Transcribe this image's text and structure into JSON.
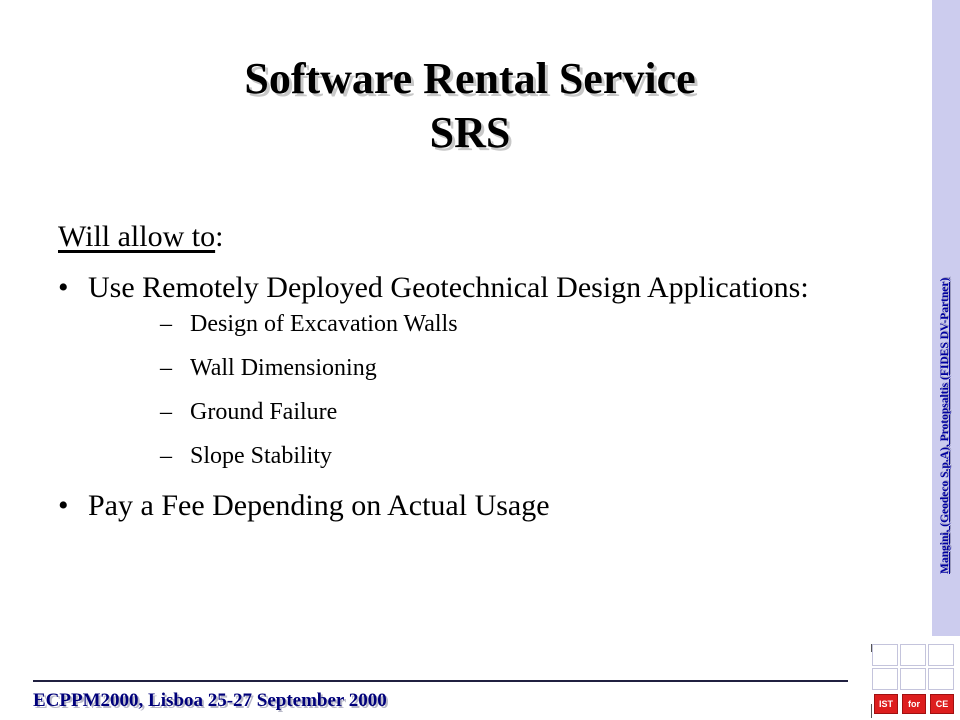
{
  "title": {
    "line1": "Software Rental Service",
    "line2": "SRS"
  },
  "intro": {
    "underlined": "Will allow to",
    "suffix": ":"
  },
  "bullet_glyph": "•",
  "dash_glyph": "–",
  "bullets": [
    {
      "text": "Use Remotely Deployed Geotechnical Design Applications:",
      "subitems": [
        "Design of Excavation Walls",
        "Wall Dimensioning",
        "Ground Failure",
        "Slope Stability"
      ]
    },
    {
      "text": "Pay a Fee Depending on Actual Usage"
    }
  ],
  "side_credit": "Mangini, (Geodeco S.p.A), Protopsaltis (FIDES DV-Partner)",
  "footer": "ECPPM2000, Lisboa 25-27 September 2000",
  "logo": {
    "tags": [
      "IST",
      "for",
      "CE"
    ]
  },
  "colors": {
    "side_bar": "#ccccee",
    "footer_text": "#00007a",
    "side_text": "#0000a0",
    "logo_red": "#dd1e1e"
  }
}
